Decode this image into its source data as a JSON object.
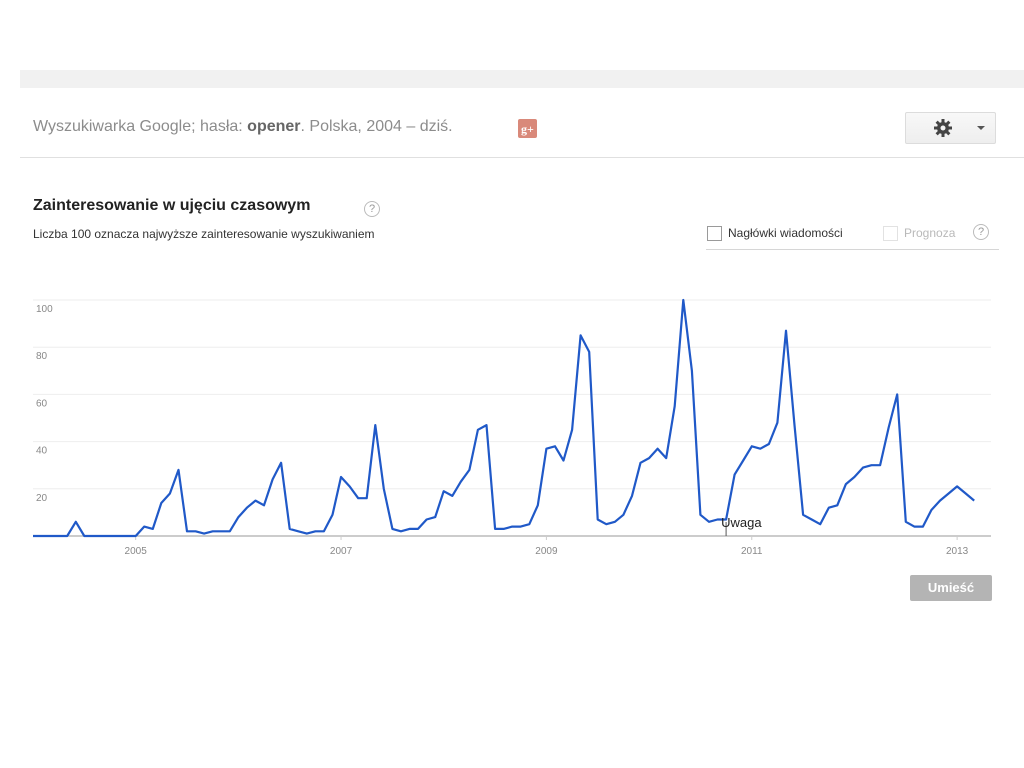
{
  "header": {
    "query_prefix": "Wyszukiwarka Google; hasła: ",
    "query_term": "opener",
    "query_suffix": ". Polska, 2004 – dziś.",
    "plus_icon_label": "g+",
    "settings_icon": "gear-icon"
  },
  "main": {
    "section_title": "Zainteresowanie w ujęciu czasowym",
    "help_glyph": "?",
    "subtitle": "Liczba 100 oznacza najwyższe zainteresowanie wyszukiwaniem",
    "checkbox_news": "Nagłówki wiadomości",
    "checkbox_forecast": "Prognoza",
    "embed_button": "Umieść"
  },
  "colors": {
    "line": "#2059c8",
    "grid": "#eeeeee",
    "baseline": "#999999",
    "tick_text": "#888888"
  },
  "chart_data": {
    "type": "line",
    "x_start_year": 2004,
    "x_step_months": 1,
    "xlim": [
      2004.0,
      2013.33
    ],
    "ylim": [
      0,
      100
    ],
    "y_ticks": [
      20,
      40,
      60,
      80,
      100
    ],
    "x_tick_labels": [
      "2005",
      "2007",
      "2009",
      "2011",
      "2013"
    ],
    "x_tick_values": [
      2005,
      2007,
      2009,
      2011,
      2013
    ],
    "annotation": {
      "text": "Uwaga",
      "x": 2010.75
    },
    "series": [
      {
        "values": [
          0,
          0,
          0,
          0,
          0,
          6,
          0,
          0,
          0,
          0,
          0,
          0,
          0,
          4,
          3,
          14,
          18,
          28,
          2,
          2,
          1,
          2,
          2,
          2,
          8,
          12,
          15,
          13,
          24,
          31,
          3,
          2,
          1,
          2,
          2,
          9,
          25,
          21,
          16,
          16,
          47,
          20,
          3,
          2,
          3,
          3,
          7,
          8,
          19,
          17,
          23,
          28,
          45,
          47,
          3,
          3,
          4,
          4,
          5,
          13,
          37,
          38,
          32,
          45,
          85,
          78,
          7,
          5,
          6,
          9,
          17,
          31,
          33,
          37,
          33,
          55,
          100,
          70,
          9,
          6,
          7,
          7,
          26,
          32,
          38,
          37,
          39,
          48,
          87,
          47,
          9,
          7,
          5,
          12,
          13,
          22,
          25,
          29,
          30,
          30,
          46,
          60,
          6,
          4,
          4,
          11,
          15,
          18,
          21,
          18,
          15
        ]
      }
    ]
  }
}
